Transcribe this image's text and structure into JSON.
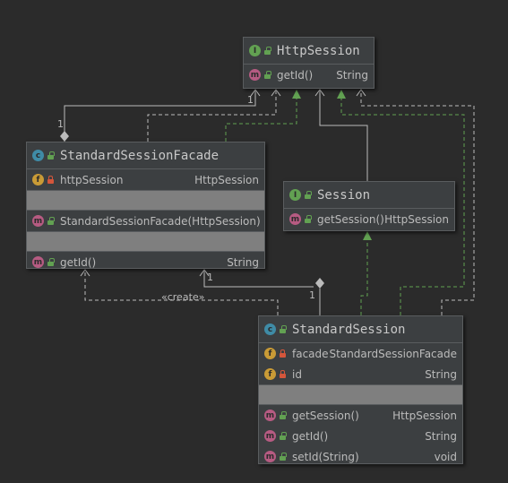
{
  "http_session": {
    "name": "HttpSession",
    "methods": [
      {
        "name": "getId()",
        "type": "String"
      }
    ]
  },
  "facade": {
    "name": "StandardSessionFacade",
    "fields": [
      {
        "name": "httpSession",
        "type": "HttpSession"
      }
    ],
    "constructors": [
      {
        "name": "StandardSessionFacade(HttpSession)",
        "type": ""
      }
    ],
    "methods": [
      {
        "name": "getId()",
        "type": "String"
      }
    ]
  },
  "session": {
    "name": "Session",
    "methods": [
      {
        "name": "getSession()",
        "type": "HttpSession"
      }
    ]
  },
  "standard_session": {
    "name": "StandardSession",
    "fields": [
      {
        "name": "facade",
        "type": "StandardSessionFacade"
      },
      {
        "name": "id",
        "type": "String"
      }
    ],
    "methods": [
      {
        "name": "getSession()",
        "type": "HttpSession"
      },
      {
        "name": "getId()",
        "type": "String"
      },
      {
        "name": "setId(String)",
        "type": "void"
      }
    ]
  },
  "edge_labels": {
    "facade_mult_top": "1",
    "facade_mult_http": "1",
    "create_label": "«create»",
    "ss_mult_facade": "1",
    "ss_mult_self": "1"
  },
  "icons": {
    "interface": "interface-icon",
    "class": "class-icon",
    "field": "field-icon",
    "method": "method-icon",
    "public": "public-lock-icon",
    "private": "private-lock-icon"
  },
  "colors": {
    "background": "#2b2b2b",
    "box": "#3c3f41",
    "realization": "#62a152",
    "association": "#bbbbbb"
  }
}
